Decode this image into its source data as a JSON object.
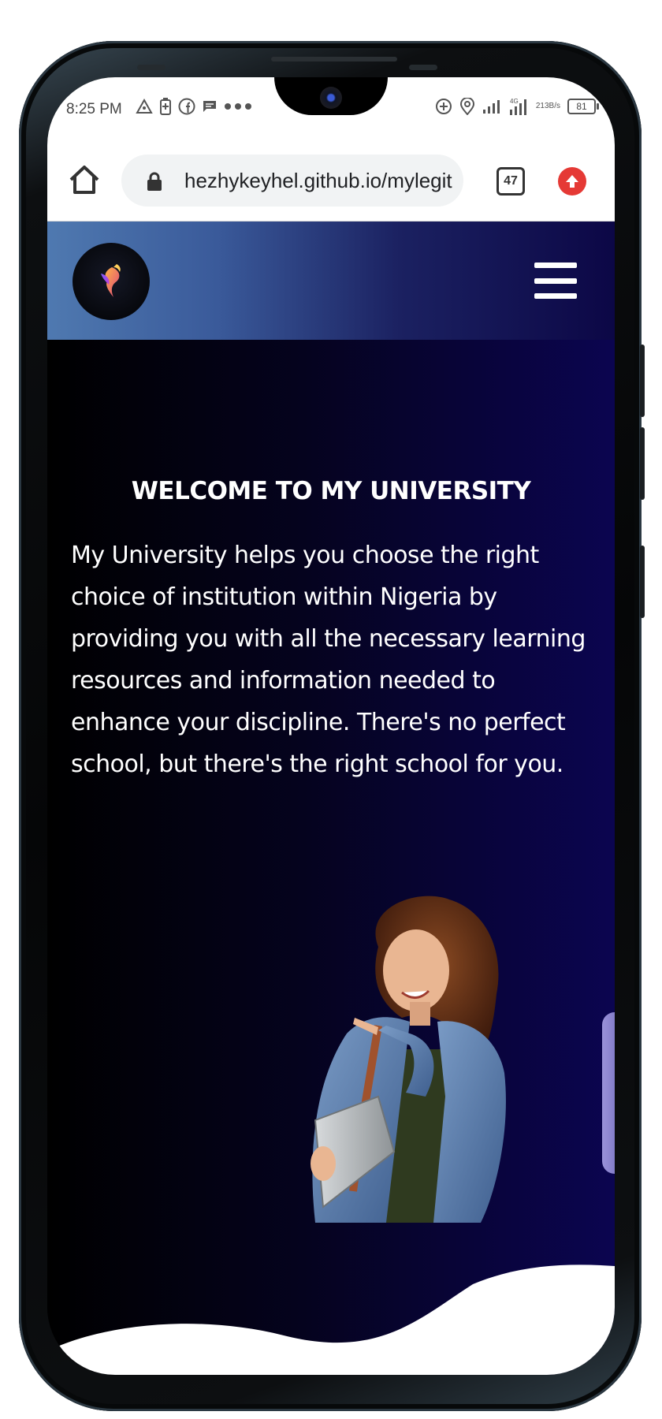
{
  "status_bar": {
    "time": "8:25 PM",
    "left_icons": [
      "delta-icon",
      "battery-saver-icon",
      "facebook-icon",
      "message-icon",
      "more-dots-icon"
    ],
    "right_icons": [
      "sync-icon",
      "location-icon",
      "signal-icon",
      "4g-signal-icon"
    ],
    "network_speed_value": "213",
    "network_speed_unit": "B/s",
    "battery_level": "81"
  },
  "browser": {
    "url": "hezhykeyhel.github.io/mylegit",
    "tab_count": "47",
    "accent_update_color": "#e53935"
  },
  "header": {
    "logo_icon": "phoenix-logo-icon",
    "menu_icon": "hamburger-menu-icon"
  },
  "hero": {
    "title": "WELCOME TO MY UNIVERSITY",
    "description": "My University helps you choose the right choice of institution within Nigeria by providing you with all the necessary learning resources and information needed to enhance your discipline. There's no perfect school, but there's the right school for you.",
    "image": "student-with-laptop-illustration"
  },
  "colors": {
    "header_gradient_start": "#4f79b0",
    "header_gradient_end": "#0c0746",
    "page_gradient_start": "#000000",
    "page_gradient_end": "#0b0550"
  }
}
